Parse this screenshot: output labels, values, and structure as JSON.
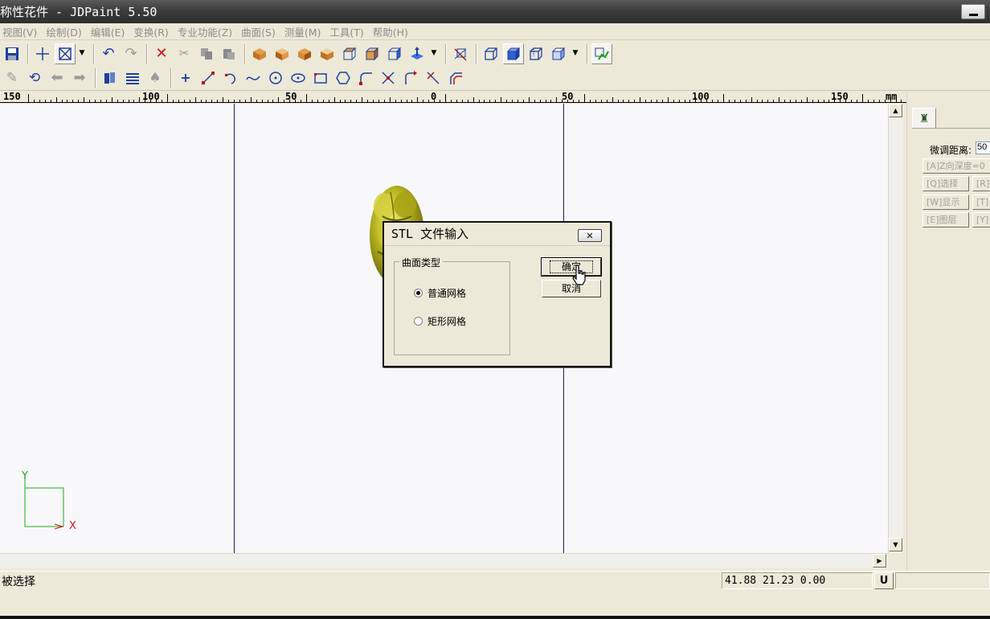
{
  "window": {
    "title": "称性花件 - JDPaint 5.50"
  },
  "menu": [
    "视图(V)",
    "绘制(D)",
    "编辑(E)",
    "变换(R)",
    "专业功能(Z)",
    "曲面(S)",
    "测量(M)",
    "工具(T)",
    "帮助(H)"
  ],
  "ruler": {
    "labels": [
      "150",
      "100",
      "50",
      "0",
      "50",
      "100",
      "150"
    ],
    "unit": "mm"
  },
  "panel": {
    "label": "微调距离:",
    "value": "50",
    "buttons": [
      "[A]Z向深度=0",
      "[Q]选择",
      "[R]",
      "[W]显示",
      "[T]",
      "[E]图层",
      "[Y]"
    ]
  },
  "dialog": {
    "title": "STL 文件输入",
    "group_label": "曲面类型",
    "options": [
      {
        "label": "普通网格",
        "selected": true
      },
      {
        "label": "矩形网格",
        "selected": false
      }
    ],
    "ok": "确定",
    "cancel": "取消"
  },
  "axes": {
    "y": "Y",
    "x": "X"
  },
  "status": {
    "message": "被选择",
    "coords": "41.88 21.23 0.00",
    "u_label": "U"
  },
  "colors": {
    "axis": "#1aaa1a",
    "guide": "#1c1c66",
    "model": "#a8a818",
    "axis_x_label": "#d01818"
  }
}
